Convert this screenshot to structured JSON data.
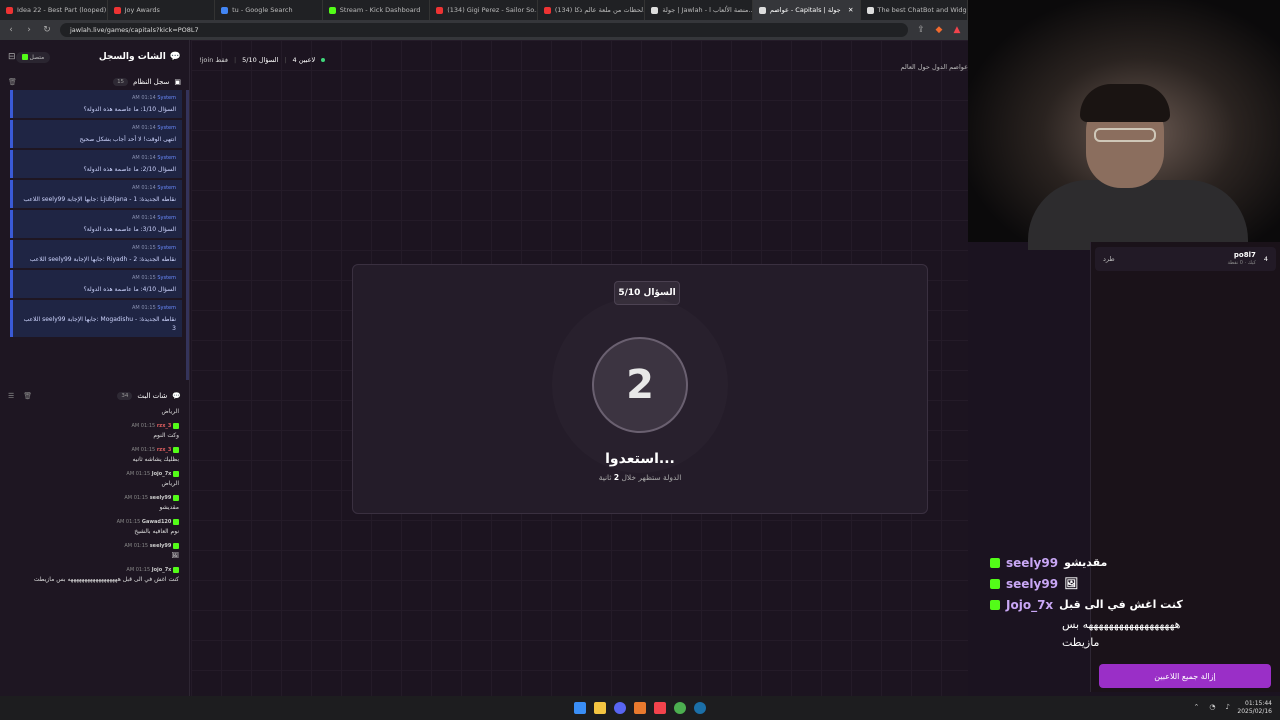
{
  "browser": {
    "tabs": [
      {
        "label": "Idea 22 - Best Part (looped)",
        "color": "#e33"
      },
      {
        "label": "Joy Awards",
        "color": "#e33"
      },
      {
        "label": "tu - Google Search",
        "color": "#4285f4"
      },
      {
        "label": "Stream - Kick Dashboard",
        "color": "#53fc18"
      },
      {
        "label": "(134) Gigi Perez - Sailor So...",
        "color": "#e33"
      },
      {
        "label": "(134) لحظات من ملعة عالم ذكا...",
        "color": "#e33"
      },
      {
        "label": "جولة | Jawlah - منصة الألعاب ا...",
        "color": "#ddd"
      },
      {
        "label": "عواصم - Capitals | جولة",
        "color": "#ddd",
        "active": true
      },
      {
        "label": "The best ChatBot and Widget...",
        "color": "#ddd"
      }
    ],
    "url": "jawlah.live/games/capitals?kick=PO8L7"
  },
  "sidebar": {
    "title": "الشات والسجل",
    "status": "متصل",
    "system_log": {
      "title": "سجل النظام",
      "count": "15",
      "items": [
        {
          "time": "AM 01:14",
          "user": "System",
          "text": "السؤال 1/10: ما عاصمة هذه الدولة؟"
        },
        {
          "time": "AM 01:14",
          "user": "System",
          "text": "انتهى الوقت! لا أحد أجاب بشكل صحيح"
        },
        {
          "time": "AM 01:14",
          "user": "System",
          "text": "السؤال 2/10: ما عاصمة هذه الدولة؟"
        },
        {
          "time": "AM 01:14",
          "user": "System",
          "text": "اللاعب seely99 جابها الإجابة: Ljubljana - نقاطه الجديدة: 1"
        },
        {
          "time": "AM 01:14",
          "user": "System",
          "text": "السؤال 3/10: ما عاصمة هذه الدولة؟"
        },
        {
          "time": "AM 01:15",
          "user": "System",
          "text": "اللاعب seely99 جابها الإجابة: Riyadh - نقاطه الجديدة: 2"
        },
        {
          "time": "AM 01:15",
          "user": "System",
          "text": "السؤال 4/10: ما عاصمة هذه الدولة؟"
        },
        {
          "time": "AM 01:15",
          "user": "System",
          "text": "اللاعب seely99 جابها الإجابة: Mogadishu - نقاطه الجديدة: 3"
        }
      ]
    },
    "stream_chat": {
      "title": "شات البث",
      "count": "34",
      "items": [
        {
          "time": "",
          "user": "",
          "text": "الرياض"
        },
        {
          "time": "AM 01:15",
          "user": "rzx_3",
          "red": true,
          "text": "وكت النوم"
        },
        {
          "time": "AM 01:15",
          "user": "rzx_3",
          "red": true,
          "text": "بظليك يشاشه ثانيه"
        },
        {
          "time": "AM 01:15",
          "user": "Jojo_7x",
          "text": "الرياض"
        },
        {
          "time": "AM 01:15",
          "user": "seely99",
          "text": "مقديشو"
        },
        {
          "time": "AM 01:15",
          "user": "Gawad120",
          "text": "نوم العافيه بالشيخ"
        },
        {
          "time": "AM 01:15",
          "user": "seely99",
          "text": "🖼"
        },
        {
          "time": "AM 01:15",
          "user": "Jojo_7x",
          "text": "كنت اغش في الى قبل ههههههههههههههههههه بس مازيطت"
        }
      ]
    }
  },
  "main": {
    "players_count": "4 لاعبين",
    "question_progress": "السؤال 5/10",
    "join_hint": "!join فقط",
    "page_title": "عواصم الدول حول العالم",
    "card": {
      "question_badge": "السؤال 5/10",
      "countdown": "2",
      "ready_text": "استعدوا...",
      "sub_prefix": "الدولة ستظهر خلال",
      "sub_seconds": "2",
      "sub_suffix": "ثانية"
    }
  },
  "players": {
    "rank": "4",
    "name": "po8l7",
    "meta": "كيك · 0 نقطة",
    "kick_label": "طرد",
    "remove_all": "إزالة جميع اللاعبين"
  },
  "overlay": {
    "lines": [
      {
        "user": "seely99",
        "msg": "مقديشو"
      },
      {
        "user": "seely99",
        "msg": "🖼"
      },
      {
        "user": "Jojo_7x",
        "msg": "كنت اغش في الى قبل"
      }
    ],
    "wrap1": "ههههههههههههههههههه بس",
    "wrap2": "مازيطت"
  },
  "taskbar": {
    "time": "01:15:44",
    "date": "2025/02/16"
  }
}
